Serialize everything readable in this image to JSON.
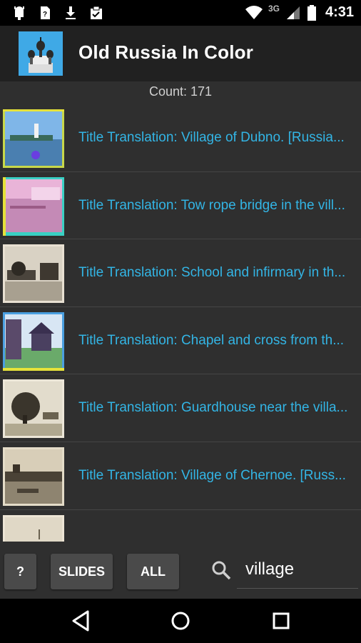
{
  "status_bar": {
    "left_icons": [
      "android-icon",
      "sim-card-icon",
      "download-icon",
      "clipboard-check-icon"
    ],
    "right_icons": [
      "wifi-icon",
      "signal-icon",
      "battery-icon"
    ],
    "network": "3G",
    "time": "4:31"
  },
  "app": {
    "title": "Old Russia In Color",
    "logo_icon": "church-domes-icon"
  },
  "count_label": "Count: 171",
  "items": [
    {
      "title": "Title Translation: Village of Dubno. [Russia...",
      "thumb": "lake-village-color"
    },
    {
      "title": "Title Translation: Tow rope bridge in the vill...",
      "thumb": "pink-river-bridge"
    },
    {
      "title": "Title Translation: School and infirmary in th...",
      "thumb": "sepia-buildings"
    },
    {
      "title": "Title Translation: Chapel and cross from th...",
      "thumb": "color-chapel"
    },
    {
      "title": "Title Translation: Guardhouse near the villa...",
      "thumb": "sepia-tree"
    },
    {
      "title": "Title Translation: Village of Chernoe. [Russ...",
      "thumb": "sepia-river-village"
    },
    {
      "title": "",
      "thumb": "sepia-sky"
    }
  ],
  "toolbar": {
    "help_label": "?",
    "slides_label": "SLIDES",
    "all_label": "ALL",
    "search_value": "village"
  },
  "nav": [
    "back-icon",
    "home-icon",
    "recents-icon"
  ],
  "colors": {
    "accent": "#33b5e5",
    "background": "#2f2f2f",
    "appbar": "#212121"
  }
}
